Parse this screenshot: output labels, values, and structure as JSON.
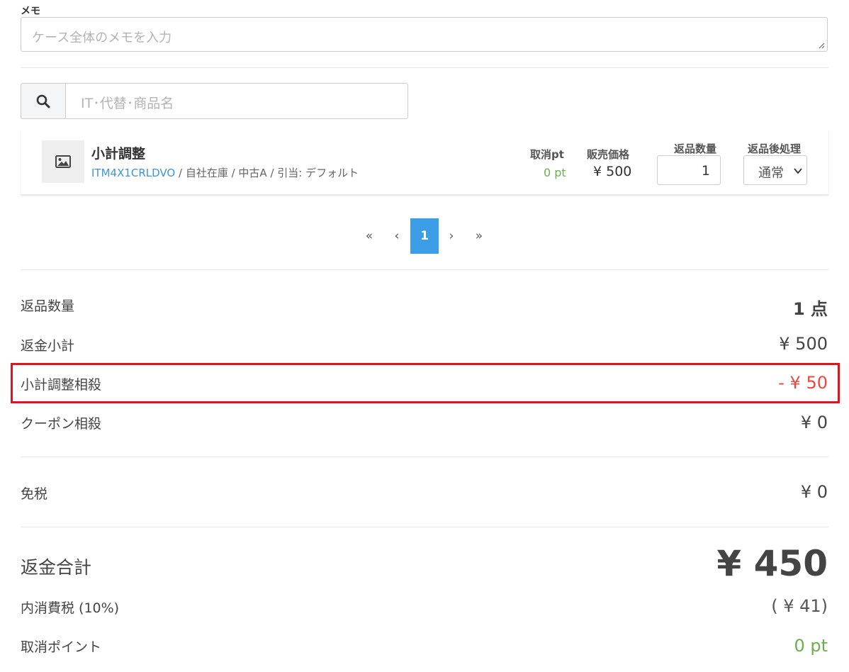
{
  "memo": {
    "label": "メモ",
    "placeholder": "ケース全体のメモを入力"
  },
  "search": {
    "placeholder": "IT･代替･商品名",
    "icon": "search-icon"
  },
  "item": {
    "name": "小計調整",
    "code": "ITM4X1CRLDVO",
    "meta_rest": " / 自社在庫 / 中古A / 引当: デフォルト",
    "cancel_pt_label": "取消pt",
    "cancel_pt_value": "0 pt",
    "price_label": "販売価格",
    "price_value": "¥ 500",
    "qty_label": "返品数量",
    "qty_value": "1",
    "after_label": "返品後処理",
    "after_value": "通常"
  },
  "pagination": {
    "first": "«",
    "prev": "‹",
    "current": "1",
    "next": "›",
    "last": "»"
  },
  "summary": {
    "qty_label": "返品数量",
    "qty_value": "1 点",
    "subtotal_label": "返金小計",
    "subtotal_value": "¥ 500",
    "adjust_label": "小計調整相殺",
    "adjust_value": "- ¥ 50",
    "coupon_label": "クーポン相殺",
    "coupon_value": "¥ 0",
    "taxfree_label": "免税",
    "taxfree_value": "¥ 0",
    "total_label": "返金合計",
    "total_value": "¥ 450",
    "tax_label": "内消費税 (10%)",
    "tax_value": "( ¥ 41)",
    "points_label": "取消ポイント",
    "points_value": "0 pt"
  },
  "colors": {
    "accent": "#3d9ee8",
    "negative": "#e8493f",
    "positive": "#6ab04c",
    "highlight_border": "#e0141e",
    "link": "#3a95dc"
  }
}
